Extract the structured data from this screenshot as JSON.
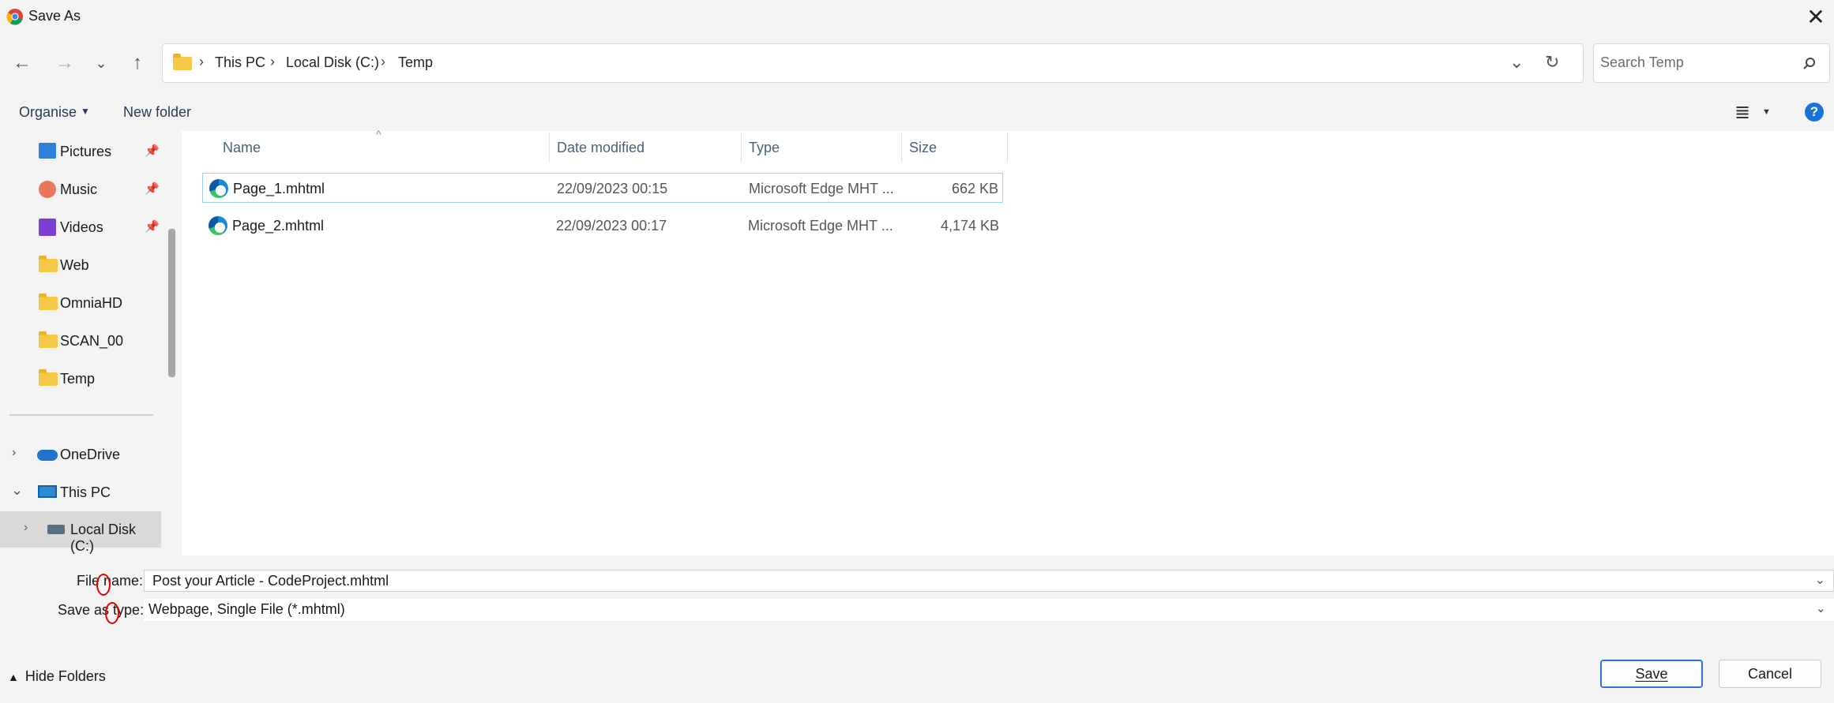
{
  "window": {
    "title": "Save As"
  },
  "address": {
    "crumbs": [
      "This PC",
      "Local Disk (C:)",
      "Temp"
    ]
  },
  "search": {
    "placeholder": "Search Temp"
  },
  "toolbar": {
    "organise_label": "Organise",
    "new_folder_label": "New folder",
    "help_label": "?"
  },
  "nav": {
    "items": [
      {
        "label": "Pictures",
        "pinned": true
      },
      {
        "label": "Music",
        "pinned": true
      },
      {
        "label": "Videos",
        "pinned": true
      },
      {
        "label": "Web"
      },
      {
        "label": "OmniaHD"
      },
      {
        "label": "SCAN_00"
      },
      {
        "label": "Temp"
      }
    ],
    "tree": [
      {
        "label": "OneDrive",
        "expanded": false
      },
      {
        "label": "This PC",
        "expanded": true
      },
      {
        "label": "Local Disk (C:)",
        "selected": true
      }
    ]
  },
  "files": {
    "columns": [
      "Name",
      "Date modified",
      "Type",
      "Size"
    ],
    "rows": [
      {
        "name": "Page_1.mhtml",
        "modified": "22/09/2023 00:15",
        "type": "Microsoft Edge MHT ...",
        "size": "662 KB"
      },
      {
        "name": "Page_2.mhtml",
        "modified": "22/09/2023 00:17",
        "type": "Microsoft Edge MHT ...",
        "size": "4,174 KB"
      }
    ]
  },
  "form": {
    "filename_label": "File name:",
    "filename_value": "Post your Article - CodeProject.mhtml",
    "savetype_label": "Save as type:",
    "savetype_value": "Webpage, Single File (*.mhtml)"
  },
  "footer": {
    "hide_folders_label": "Hide Folders",
    "save_label": "Save",
    "cancel_label": "Cancel"
  },
  "colors": {
    "accent": "#2f72d8",
    "selection_border": "#99d1ff",
    "annotation_red": "#e30000"
  }
}
